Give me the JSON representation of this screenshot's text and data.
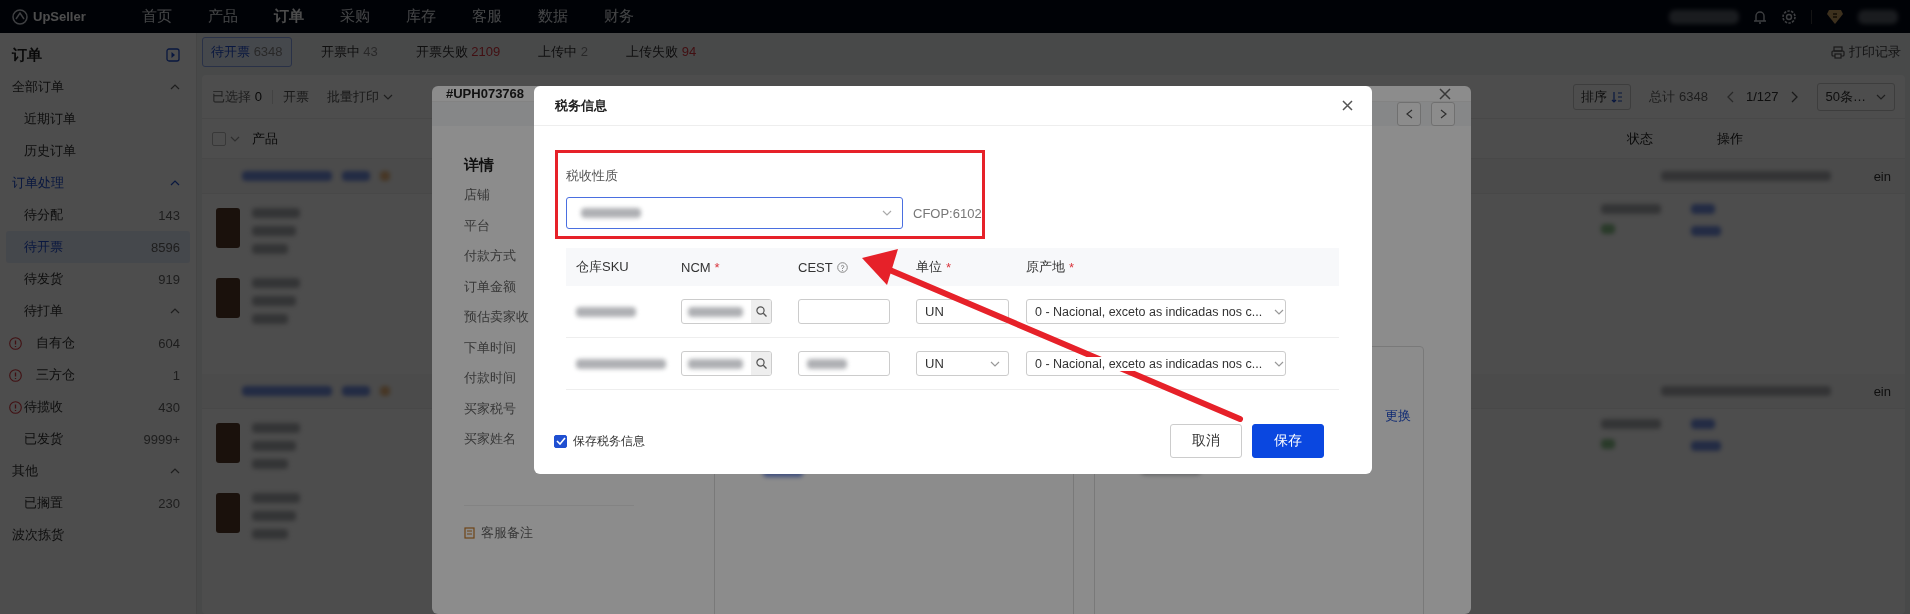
{
  "nav": {
    "logo": "UpSeller",
    "items": [
      {
        "label": "首页",
        "selected": false
      },
      {
        "label": "产品",
        "selected": false
      },
      {
        "label": "订单",
        "selected": true
      },
      {
        "label": "采购",
        "selected": false
      },
      {
        "label": "库存",
        "selected": false
      },
      {
        "label": "客服",
        "selected": false
      },
      {
        "label": "数据",
        "selected": false
      },
      {
        "label": "财务",
        "selected": false
      }
    ]
  },
  "sidebar": {
    "title": "订单",
    "items": [
      {
        "label": "全部订单",
        "expanded": true,
        "children": [
          {
            "label": "近期订单",
            "selected": false
          },
          {
            "label": "历史订单",
            "selected": false
          }
        ]
      },
      {
        "label": "订单处理",
        "expanded": true,
        "children": [
          {
            "label": "待分配",
            "count": "143",
            "selected": false,
            "warning": false
          },
          {
            "label": "待开票",
            "count": "8596",
            "selected": true,
            "warning": false
          },
          {
            "label": "待发货",
            "count": "919",
            "selected": false,
            "warning": false
          },
          {
            "label": "待打单",
            "expanded": true,
            "children": [
              {
                "label": "自有仓",
                "count": "604",
                "selected": false,
                "warning": true
              },
              {
                "label": "三方仓",
                "count": "1",
                "selected": false,
                "warning": true
              }
            ]
          },
          {
            "label": "待揽收",
            "count": "430",
            "selected": false,
            "warning": true
          },
          {
            "label": "已发货",
            "count": "9999+",
            "selected": false,
            "warning": false
          }
        ]
      },
      {
        "label": "其他",
        "expanded": true,
        "children": [
          {
            "label": "已搁置",
            "count": "230",
            "selected": false,
            "warning": false
          }
        ]
      },
      {
        "label": "波次拣货",
        "selected": false
      }
    ]
  },
  "status_tabs": [
    {
      "label": "待开票",
      "count": "6348",
      "selected": true,
      "alert": false
    },
    {
      "label": "开票中",
      "count": "43",
      "selected": false,
      "alert": false
    },
    {
      "label": "开票失败",
      "count": "2109",
      "selected": false,
      "alert": true
    },
    {
      "label": "上传中",
      "count": "2",
      "selected": false,
      "alert": false
    },
    {
      "label": "上传失败",
      "count": "94",
      "selected": false,
      "alert": true
    }
  ],
  "print_log": "打印记录",
  "toolbar": {
    "selected_label": "已选择",
    "selected_count": "0",
    "actions": [
      {
        "label": "开票",
        "dropdown": false
      },
      {
        "label": "批量打印",
        "dropdown": true
      }
    ],
    "sort": "排序",
    "total": "总计 6348",
    "page": "1/127",
    "page_size": "50条…"
  },
  "table": {
    "select_all_checked": false,
    "columns": [
      "产品",
      "状态",
      "操作"
    ],
    "orders": [
      {
        "tail_text": "ein"
      },
      {
        "tail_text": "ein"
      }
    ]
  },
  "order_detail": {
    "title": "#UPH073768",
    "section": "详情",
    "fields": [
      "店铺",
      "平台",
      "付款方式",
      "订单金额",
      "预估卖家收",
      "下单时间",
      "付款时间",
      "买家税号",
      "买家姓名"
    ],
    "note_label": "客服备注",
    "link": "更换"
  },
  "tax_dialog": {
    "title": "税务信息",
    "nature_label": "税收性质",
    "cfop": "CFOP:6102",
    "required_mark": "*",
    "columns": [
      {
        "label": "仓库SKU",
        "required": false,
        "help": false
      },
      {
        "label": "NCM",
        "required": true,
        "help": false
      },
      {
        "label": "CEST",
        "required": false,
        "help": true
      },
      {
        "label": "单位",
        "required": true,
        "help": false
      },
      {
        "label": "原产地",
        "required": true,
        "help": false
      }
    ],
    "rows": [
      {
        "cest_filled": false,
        "unit": "UN",
        "unit_dropdown": false,
        "origin": "0 - Nacional, exceto as indicadas nos c..."
      },
      {
        "cest_filled": true,
        "unit": "UN",
        "unit_dropdown": true,
        "origin": "0 - Nacional, exceto as indicadas nos c..."
      }
    ],
    "save_info": {
      "label": "保存税务信息",
      "checked": true
    },
    "cancel": "取消",
    "save": "保存"
  }
}
